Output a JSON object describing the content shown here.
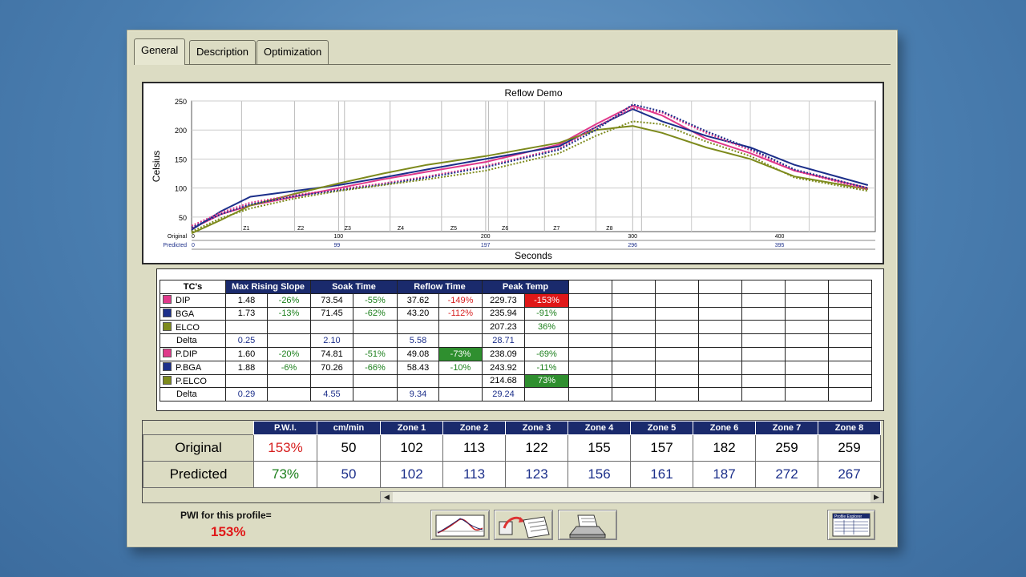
{
  "tabs": [
    "General",
    "Description",
    "Optimization"
  ],
  "chart_data": {
    "type": "line",
    "title": "Reflow Demo",
    "ylabel": "Celsius",
    "xlabel": "Seconds",
    "ylim": [
      0,
      250
    ],
    "yticks": [
      50,
      100,
      150,
      200,
      250
    ],
    "x_axis_rows": [
      {
        "label": "Original",
        "ticks": [
          "0",
          "100",
          "200",
          "300",
          "400"
        ]
      },
      {
        "label": "Predicted",
        "ticks": [
          "0",
          "99",
          "197",
          "296",
          "395"
        ]
      }
    ],
    "zone_markers": [
      "Z1",
      "Z2",
      "Z3",
      "Z4",
      "Z5",
      "Z6",
      "Z7",
      "Z8"
    ],
    "series": [
      {
        "color": "#e0398b",
        "style": "solid",
        "x": [
          0,
          20,
          40,
          70,
          100,
          130,
          160,
          200,
          250,
          275,
          300,
          320,
          350,
          380,
          410,
          460
        ],
        "y": [
          30,
          55,
          70,
          85,
          100,
          115,
          128,
          145,
          175,
          210,
          242,
          225,
          185,
          160,
          130,
          100
        ]
      },
      {
        "color": "#1c2f8a",
        "style": "solid",
        "x": [
          0,
          20,
          40,
          70,
          100,
          130,
          160,
          200,
          250,
          275,
          300,
          320,
          350,
          380,
          410,
          460
        ],
        "y": [
          28,
          60,
          85,
          95,
          105,
          118,
          132,
          150,
          172,
          205,
          236,
          215,
          190,
          170,
          140,
          105
        ]
      },
      {
        "color": "#7d8a1c",
        "style": "solid",
        "x": [
          0,
          20,
          40,
          70,
          100,
          130,
          160,
          200,
          250,
          275,
          300,
          320,
          350,
          380,
          410,
          460
        ],
        "y": [
          22,
          45,
          70,
          90,
          108,
          125,
          140,
          155,
          178,
          200,
          207,
          195,
          170,
          150,
          120,
          98
        ]
      },
      {
        "color": "#e0398b",
        "style": "dashed",
        "x": [
          0,
          20,
          40,
          70,
          100,
          130,
          160,
          200,
          250,
          275,
          300,
          320,
          350,
          380,
          410,
          460
        ],
        "y": [
          35,
          58,
          75,
          88,
          98,
          108,
          120,
          138,
          168,
          205,
          238,
          230,
          195,
          165,
          130,
          97
        ]
      },
      {
        "color": "#1c2f8a",
        "style": "dashed",
        "x": [
          0,
          20,
          40,
          70,
          100,
          130,
          160,
          200,
          250,
          275,
          300,
          320,
          350,
          380,
          410,
          460
        ],
        "y": [
          32,
          55,
          72,
          86,
          96,
          106,
          118,
          136,
          166,
          200,
          244,
          232,
          198,
          168,
          132,
          100
        ]
      },
      {
        "color": "#7d8a1c",
        "style": "dashed",
        "x": [
          0,
          20,
          40,
          70,
          100,
          130,
          160,
          200,
          250,
          275,
          300,
          320,
          350,
          380,
          410,
          460
        ],
        "y": [
          25,
          48,
          65,
          82,
          95,
          105,
          115,
          130,
          160,
          190,
          215,
          210,
          180,
          155,
          118,
          95
        ]
      }
    ]
  },
  "results_table": {
    "headers": [
      "TC's",
      "Max Rising Slope",
      "Soak Time",
      "Reflow Time",
      "Peak Temp"
    ],
    "rows": [
      {
        "name": "DIP",
        "color": "#e0398b",
        "cells": [
          "1.48",
          "-26%",
          "73.54",
          "-55%",
          "37.62",
          "-149%",
          "229.73",
          "-153%"
        ]
      },
      {
        "name": "BGA",
        "color": "#1c2f8a",
        "cells": [
          "1.73",
          "-13%",
          "71.45",
          "-62%",
          "43.20",
          "-112%",
          "235.94",
          "-91%"
        ]
      },
      {
        "name": "ELCO",
        "color": "#7d8a1c",
        "cells": [
          "",
          "",
          "",
          "",
          "",
          "",
          "207.23",
          "36%"
        ]
      },
      {
        "name": "Delta",
        "color": "",
        "cells": [
          "0.25",
          "",
          "2.10",
          "",
          "5.58",
          "",
          "28.71",
          ""
        ]
      },
      {
        "name": "P.DIP",
        "color": "#e0398b",
        "cells": [
          "1.60",
          "-20%",
          "74.81",
          "-51%",
          "49.08",
          "-73%",
          "238.09",
          "-69%"
        ]
      },
      {
        "name": "P.BGA",
        "color": "#1c2f8a",
        "cells": [
          "1.88",
          "-6%",
          "70.26",
          "-66%",
          "58.43",
          "-10%",
          "243.92",
          "-11%"
        ]
      },
      {
        "name": "P.ELCO",
        "color": "#7d8a1c",
        "cells": [
          "",
          "",
          "",
          "",
          "",
          "",
          "214.68",
          "73%"
        ]
      },
      {
        "name": "Delta",
        "color": "",
        "cells": [
          "0.29",
          "",
          "4.55",
          "",
          "9.34",
          "",
          "29.24",
          ""
        ]
      }
    ]
  },
  "zone_table": {
    "headers": [
      "P.W.I.",
      "cm/min",
      "Zone 1",
      "Zone 2",
      "Zone 3",
      "Zone 4",
      "Zone 5",
      "Zone 6",
      "Zone 7",
      "Zone 8"
    ],
    "original": {
      "label": "Original",
      "values": [
        "153%",
        "50",
        "102",
        "113",
        "122",
        "155",
        "157",
        "182",
        "259",
        "259"
      ]
    },
    "predicted": {
      "label": "Predicted",
      "values": [
        "73%",
        "50",
        "102",
        "113",
        "123",
        "156",
        "161",
        "187",
        "272",
        "267"
      ]
    }
  },
  "pwi": {
    "label": "PWI for this profile=",
    "value": "153%"
  },
  "toolbar": {
    "profile_explorer_label": "Profile Explorer"
  },
  "colors": {
    "header_blue": "#1a2a6c",
    "alert_red": "#e01818",
    "ok_green": "#2f8f2f",
    "panel_bg": "#dcdcc3"
  }
}
